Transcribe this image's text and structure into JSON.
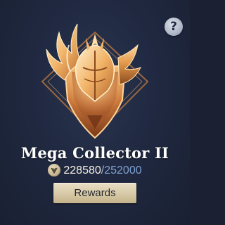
{
  "help": {
    "label": "?"
  },
  "badge": {
    "title": "Mega Collector II",
    "points_current": "228580",
    "points_separator": "/",
    "points_total": "252000",
    "icon": "collector-emblem-icon"
  },
  "rewards_button": {
    "label": "Rewards"
  },
  "colors": {
    "background": "#202941",
    "gold": "#e0a050",
    "points_total": "#7fa0cf",
    "button": "#d7c9a6"
  }
}
